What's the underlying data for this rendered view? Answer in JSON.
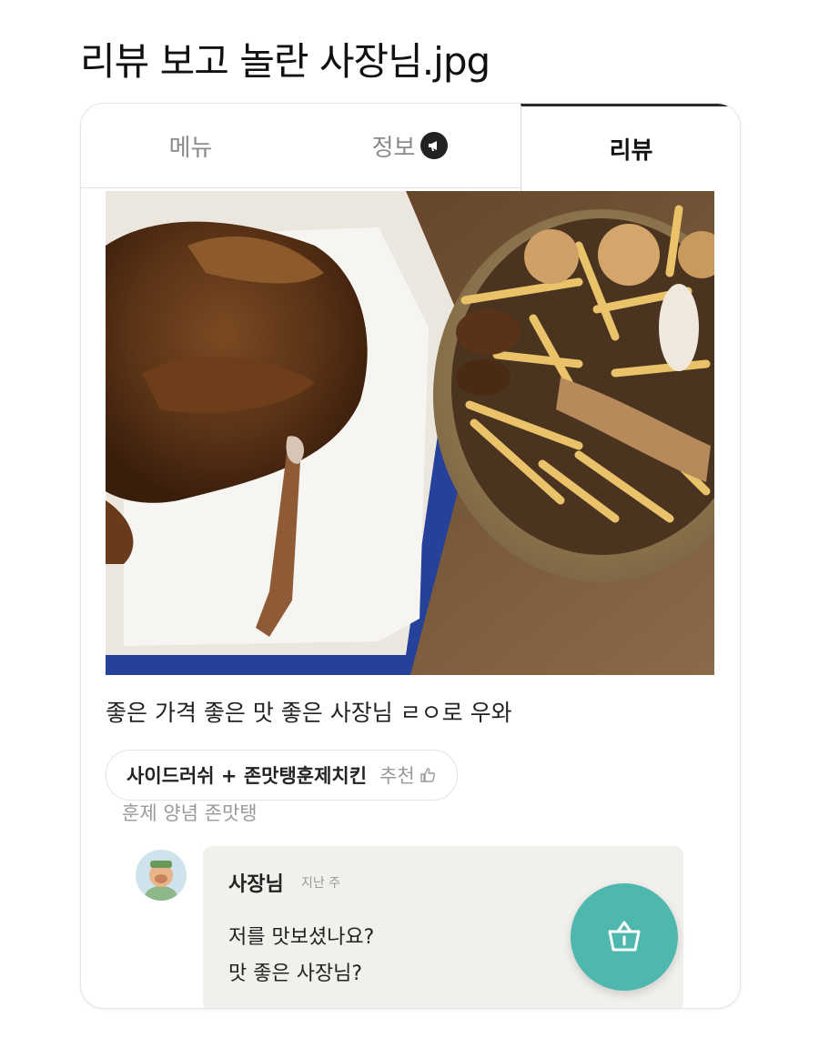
{
  "post": {
    "title": "리뷰 보고 놀란 사장님.jpg"
  },
  "tabs": [
    {
      "label": "메뉴",
      "active": false
    },
    {
      "label": "정보",
      "active": false,
      "icon": "megaphone-icon"
    },
    {
      "label": "리뷰",
      "active": true
    }
  ],
  "review": {
    "text": "좋은 가격 좋은 맛 좋은 사장님 ㄹㅇ로 우와",
    "menu_tag": "사이드러쉬 + 존맛탱훈제치킨",
    "recommend_label": "추천",
    "sub_text": "훈제 양념 존맛탱"
  },
  "reply": {
    "author": "사장님",
    "time": "지난 주",
    "line1": "저를 맛보셨나요?",
    "line2": "맛 좋은 사장님?"
  },
  "colors": {
    "accent": "#4fb8ae",
    "reply_bg": "#f2f0ec",
    "muted": "#9a9a9a"
  }
}
